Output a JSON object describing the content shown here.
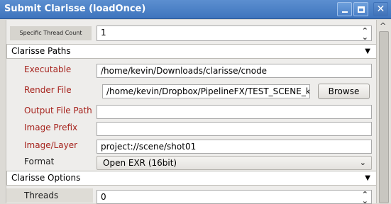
{
  "window": {
    "title": "Submit Clarisse (loadOnce)",
    "buttons": {
      "minimize": "minimize-icon",
      "maximize": "maximize-icon",
      "close": "close-icon"
    }
  },
  "top_row": {
    "label": "Specific Thread Count",
    "value": "1"
  },
  "sections": {
    "paths": "Clarisse Paths",
    "options": "Clarisse Options"
  },
  "paths": {
    "executable": {
      "label": "Executable",
      "value": "/home/kevin/Downloads/clarisse/cnode"
    },
    "render_file": {
      "label": "Render File",
      "value": "/home/kevin/Dropbox/PipelineFX/TEST_SCENE_k",
      "browse": "Browse"
    },
    "output_path": {
      "label": "Output File Path",
      "value": ""
    },
    "image_prefix": {
      "label": "Image Prefix",
      "value": ""
    },
    "image_layer": {
      "label": "Image/Layer",
      "value": "project://scene/shot01"
    },
    "format": {
      "label": "Format",
      "value": "Open EXR (16bit)"
    }
  },
  "options": {
    "threads": {
      "label": "Threads",
      "value": "0"
    }
  },
  "symbols": {
    "spin": "⌃⌄",
    "collapse": "▼",
    "chevron": "⌄",
    "close_x": "✕",
    "scroll_up": "^"
  },
  "colors": {
    "title_bar": "#3e74bd",
    "required_label": "#a6231d"
  }
}
